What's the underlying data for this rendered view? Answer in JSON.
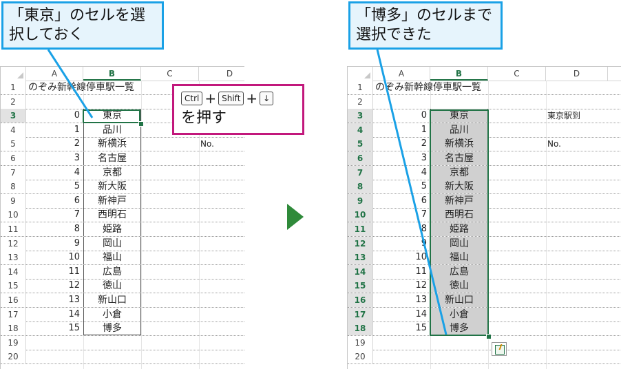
{
  "callouts": {
    "left": "「東京」のセルを選択しておく",
    "right": "「博多」のセルまで選択できた"
  },
  "shortcut": {
    "keys": [
      "Ctrl",
      "Shift",
      "↓"
    ],
    "plus": "+",
    "text": "を押す"
  },
  "columns": [
    "A",
    "B",
    "C",
    "D"
  ],
  "title": "のぞみ新幹線停車駅一覧",
  "rows": [
    "1",
    "2",
    "3",
    "4",
    "5",
    "6",
    "7",
    "8",
    "9",
    "10",
    "11",
    "12",
    "13",
    "14",
    "15",
    "16",
    "17",
    "18",
    "19",
    "20"
  ],
  "stations": [
    {
      "num": "0",
      "name": "東京"
    },
    {
      "num": "1",
      "name": "品川"
    },
    {
      "num": "2",
      "name": "新横浜"
    },
    {
      "num": "3",
      "name": "名古屋"
    },
    {
      "num": "4",
      "name": "京都"
    },
    {
      "num": "5",
      "name": "新大阪"
    },
    {
      "num": "6",
      "name": "新神戸"
    },
    {
      "num": "7",
      "name": "西明石"
    },
    {
      "num": "8",
      "name": "姫路"
    },
    {
      "num": "9",
      "name": "岡山"
    },
    {
      "num": "10",
      "name": "福山"
    },
    {
      "num": "11",
      "name": "広島"
    },
    {
      "num": "12",
      "name": "徳山"
    },
    {
      "num": "13",
      "name": "新山口"
    },
    {
      "num": "14",
      "name": "小倉"
    },
    {
      "num": "15",
      "name": "博多"
    }
  ],
  "left_d": {
    "row5": "No."
  },
  "right_d": {
    "row3": "東京駅到",
    "row5": "No."
  },
  "colors": {
    "callout_border": "#1aa1e6",
    "callout_bg": "#e6f4fc",
    "shortcut_border": "#c2187c",
    "selection": "#217346",
    "arrow": "#2f8a3a"
  },
  "icons": {
    "next": "play-arrow-icon",
    "quick_analysis": "quick-analysis-icon"
  }
}
